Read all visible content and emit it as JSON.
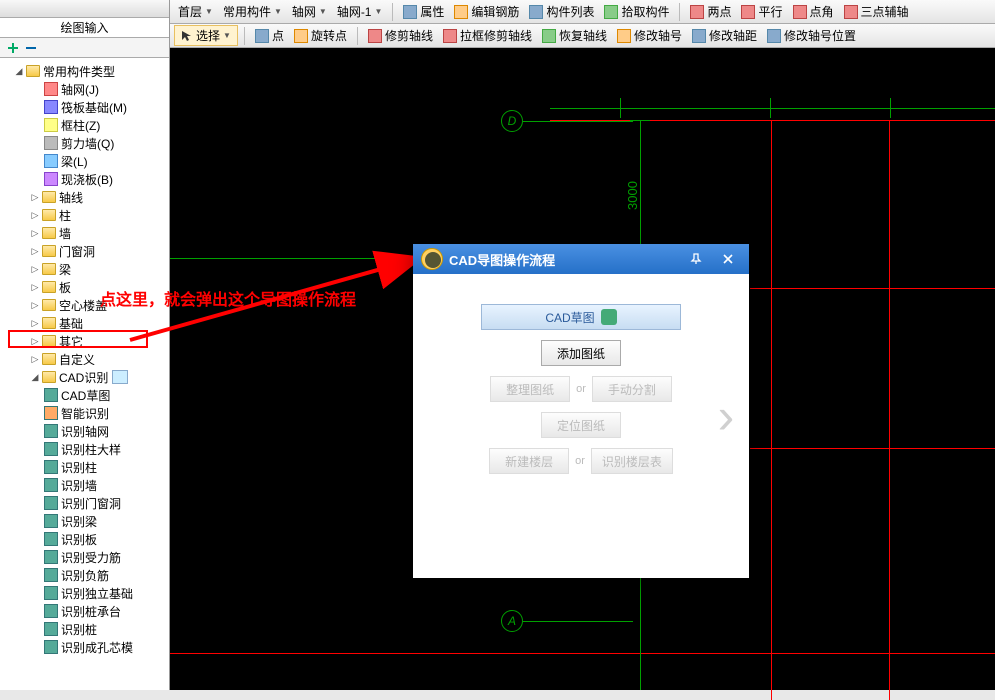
{
  "panel": {
    "header_partial": "",
    "tab": "绘图输入"
  },
  "tree": {
    "root": "常用构件类型",
    "axis_net": "轴网(J)",
    "raft": "筏板基础(M)",
    "frame_col": "框柱(Z)",
    "shear_wall": "剪力墙(Q)",
    "beam": "梁(L)",
    "slab": "现浇板(B)",
    "axis": "轴线",
    "column": "柱",
    "wall": "墙",
    "opening": "门窗洞",
    "liang": "梁",
    "ban": "板",
    "hollow": "空心楼盖",
    "foundation": "基础",
    "other": "其它",
    "custom": "自定义",
    "cad": "CAD识别",
    "cad_draft": "CAD草图",
    "smart": "智能识别",
    "rec_axis": "识别轴网",
    "rec_col_detail": "识别柱大样",
    "rec_col": "识别柱",
    "rec_wall": "识别墙",
    "rec_opening": "识别门窗洞",
    "rec_beam": "识别梁",
    "rec_slab": "识别板",
    "rec_rebar": "识别受力筋",
    "rec_neg": "识别负筋",
    "rec_iso": "识别独立基础",
    "rec_cap": "识别桩承台",
    "rec_pile": "识别桩",
    "rec_hole": "识别成孔芯模"
  },
  "toolbar1": {
    "floor": "首层",
    "component": "常用构件",
    "axis": "轴网",
    "axis_net": "轴网-1",
    "props": "属性",
    "edit_rebar": "编辑钢筋",
    "comp_list": "构件列表",
    "pick": "拾取构件",
    "two_pt": "两点",
    "parallel": "平行",
    "pt_angle": "点角",
    "three_pt": "三点辅轴"
  },
  "toolbar2": {
    "select": "选择",
    "point": "点",
    "rotate_pt": "旋转点",
    "trim_axis": "修剪轴线",
    "box_trim": "拉框修剪轴线",
    "restore": "恢复轴线",
    "modify_num": "修改轴号",
    "modify_dist": "修改轴距",
    "modify_pos": "修改轴号位置"
  },
  "annotation": "点这里，就会弹出这个导图操作流程",
  "canvas": {
    "label_d": "D",
    "label_a": "A",
    "dim_3000": "3000"
  },
  "dialog": {
    "title": "CAD导图操作流程",
    "header": "CAD草图",
    "add_drawing": "添加图纸",
    "organize": "整理图纸",
    "manual_split": "手动分割",
    "locate": "定位图纸",
    "new_floor": "新建楼层",
    "rec_floor": "识别楼层表",
    "or": "or"
  }
}
